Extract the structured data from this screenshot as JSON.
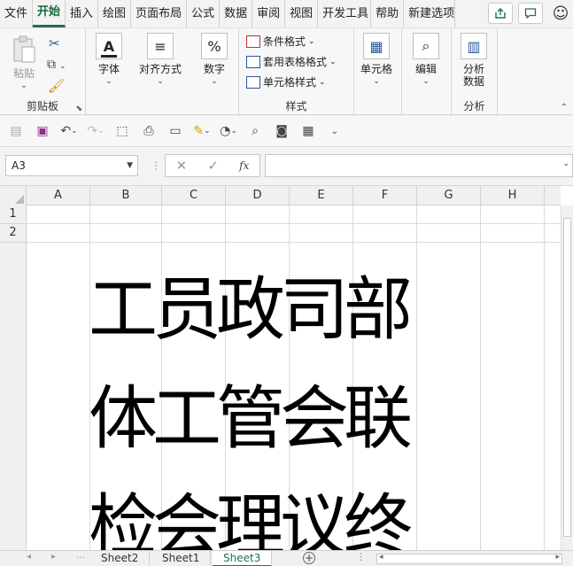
{
  "menu": {
    "tabs": [
      "文件",
      "开始",
      "插入",
      "绘图",
      "页面布局",
      "公式",
      "数据",
      "审阅",
      "视图",
      "开发工具",
      "帮助",
      "新建选项"
    ],
    "active": "开始",
    "share_icon": "share-icon",
    "comment_icon": "comment-icon",
    "feedback_icon": "smiley-icon"
  },
  "ribbon": {
    "clipboard": {
      "paste": "粘贴",
      "label": "剪贴板"
    },
    "font": {
      "label": "字体"
    },
    "alignment": {
      "label": "对齐方式"
    },
    "number": {
      "label": "数字"
    },
    "styles": {
      "conditional": "条件格式",
      "table": "套用表格格式",
      "cell_style": "单元格样式",
      "label": "样式"
    },
    "cells": {
      "label": "单元格"
    },
    "editing": {
      "label": "编辑"
    },
    "analysis": {
      "button": "分析\n数据",
      "label": "分析"
    }
  },
  "formula_bar": {
    "name_box": "A3",
    "fx": "fx",
    "value": ""
  },
  "grid": {
    "columns": [
      "A",
      "B",
      "C",
      "D",
      "E",
      "F",
      "G",
      "H"
    ],
    "rows": [
      "1",
      "2"
    ],
    "text_rows": [
      "工员政司部",
      "体工管会联",
      "检会理议终"
    ]
  },
  "sheets": {
    "tabs": [
      "Sheet2",
      "Sheet1",
      "Sheet3"
    ],
    "active": "Sheet3"
  },
  "colors": {
    "accent": "#217346"
  }
}
